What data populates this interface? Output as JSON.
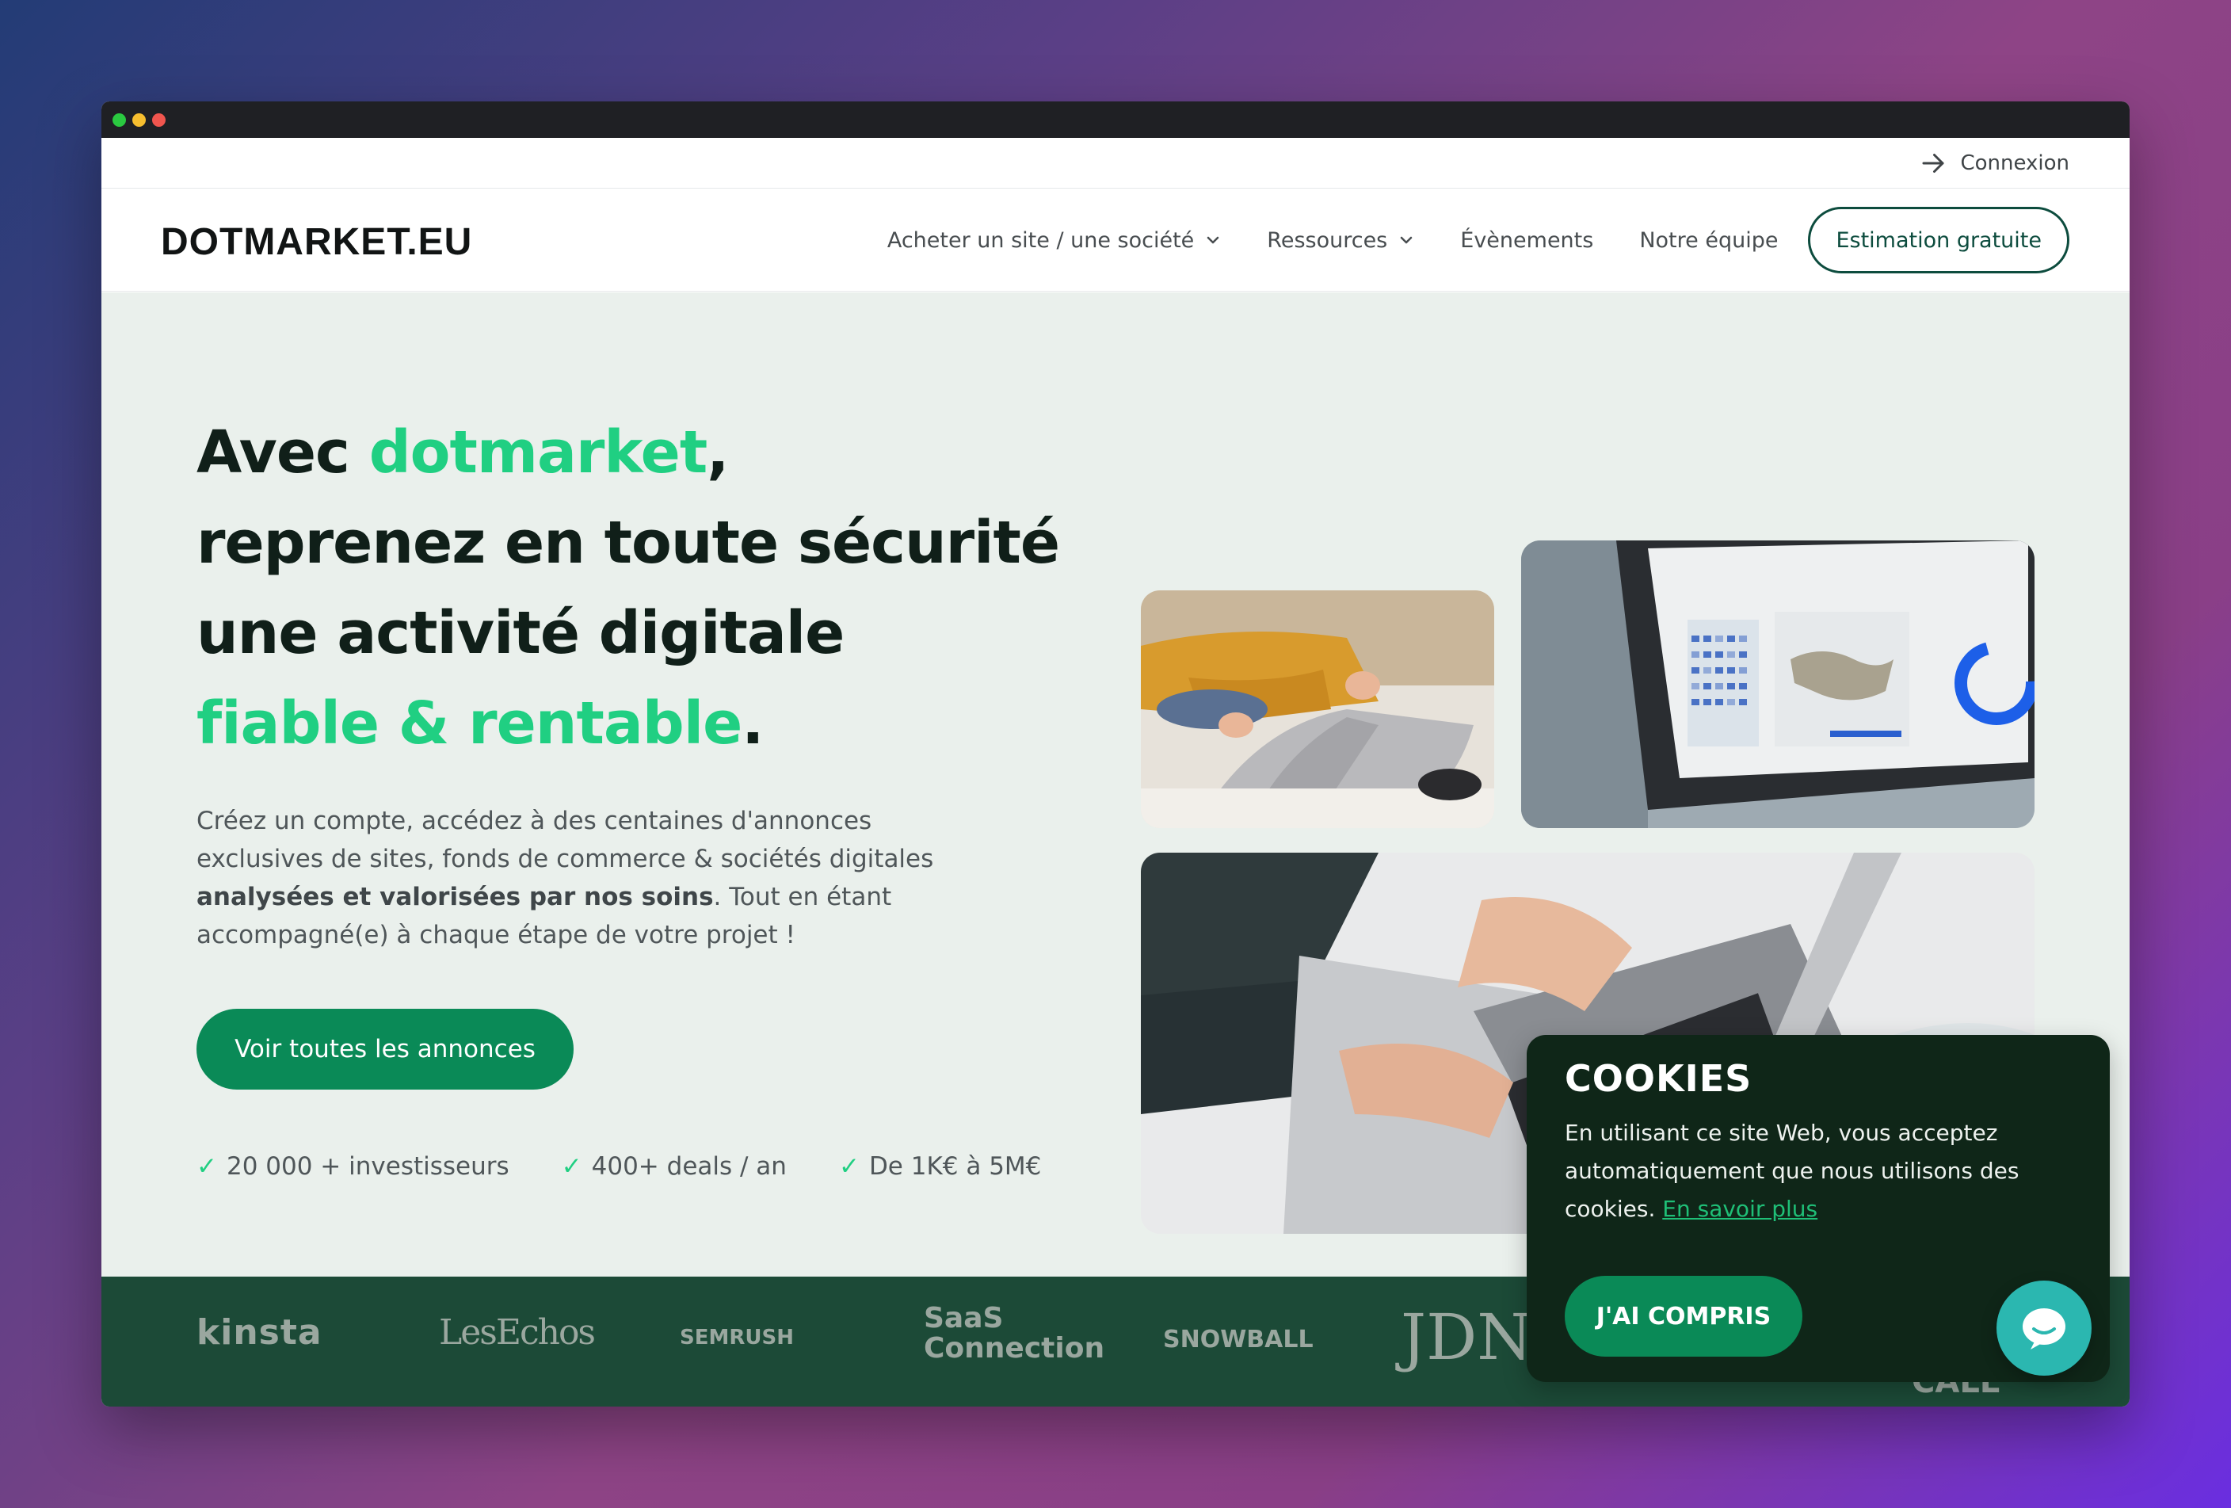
{
  "window": {
    "controls": [
      "close",
      "minimize",
      "maximize"
    ]
  },
  "topbar": {
    "login_label": "Connexion",
    "login_icon": "arrow-right-icon"
  },
  "nav": {
    "logo": "DOTMARKET.EU",
    "items": [
      {
        "label": "Acheter un site / une société",
        "has_dropdown": true
      },
      {
        "label": "Ressources",
        "has_dropdown": true
      },
      {
        "label": "Évènements",
        "has_dropdown": false
      },
      {
        "label": "Notre équipe",
        "has_dropdown": false
      }
    ],
    "cta": "Estimation gratuite"
  },
  "hero": {
    "headline": {
      "part1": "Avec ",
      "part2_green": "dotmarket",
      "part3": ",",
      "line2": "reprenez en toute sécurité",
      "line3": "une activité digitale",
      "line4_green": "fiable & rentable",
      "line4_end": "."
    },
    "description": {
      "part1": "Créez un compte, accédez à des centaines d'annonces exclusives de sites, fonds de commerce & sociétés digitales ",
      "bold": "analysées et valorisées par nos soins",
      "part2": ". Tout en étant accompagné(e) à chaque étape de votre projet !"
    },
    "cta": "Voir toutes les annonces",
    "stats": [
      {
        "check": "✓",
        "label": "20 000 + investisseurs"
      },
      {
        "check": "✓",
        "label": "400+ deals / an"
      },
      {
        "check": "✓",
        "label": "De 1K€  à 5M€"
      }
    ]
  },
  "logos": [
    "kinsta",
    "LesEchos",
    "SEMRUSH",
    "SaaS Connection",
    "SNOWBALL",
    "JDN",
    "CALL"
  ],
  "cookies": {
    "title": "COOKIES",
    "text": "En utilisant ce site Web, vous acceptez automatiquement que nous utilisons des cookies.",
    "link": "En savoir plus",
    "accept": "J'AI COMPRIS"
  },
  "colors": {
    "accent_green": "#20cf82",
    "button_green": "#0a8a57",
    "dark_green": "#0d4c3e",
    "hero_bg": "#eaf0ec",
    "logo_band": "#1c4a37",
    "cookie_bg": "#0f2618",
    "chat": "#2bb7b0"
  }
}
